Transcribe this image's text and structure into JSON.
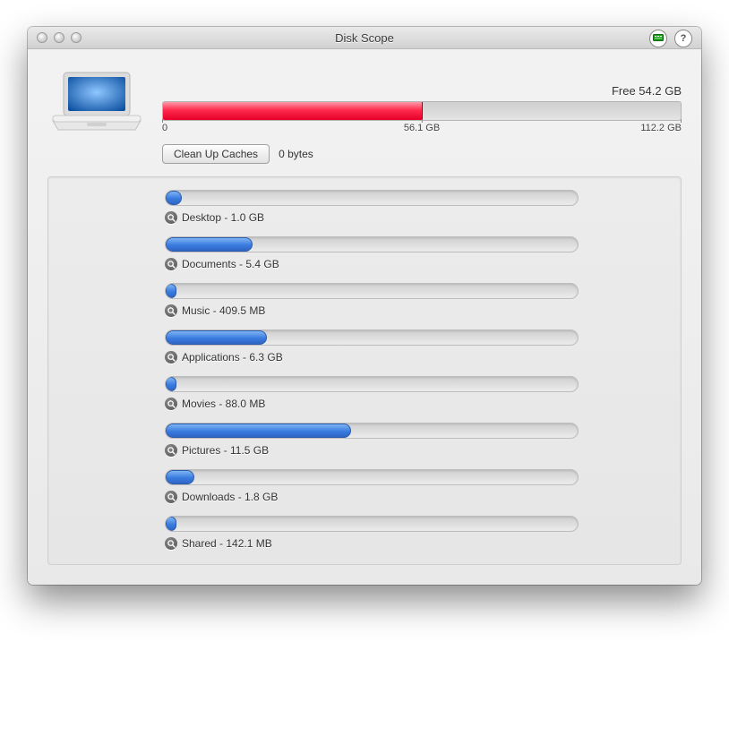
{
  "window": {
    "title": "Disk Scope"
  },
  "header_icons": {
    "board": "board-icon",
    "help": "help-icon",
    "help_label": "?"
  },
  "disk": {
    "free_label": "Free 54.2 GB",
    "total_label": "112.2 GB",
    "used_label": "56.1 GB",
    "zero_label": "0",
    "used_gb": 56.1,
    "total_gb": 112.2
  },
  "cache": {
    "button_label": "Clean Up Caches",
    "size_label": "0 bytes"
  },
  "folders": [
    {
      "name": "Desktop",
      "size_label": "1.0 GB",
      "bytes": 1073741824
    },
    {
      "name": "Documents",
      "size_label": "5.4 GB",
      "bytes": 5798205849
    },
    {
      "name": "Music",
      "size_label": "409.5 MB",
      "bytes": 429391872
    },
    {
      "name": "Applications",
      "size_label": "6.3 GB",
      "bytes": 6764573491
    },
    {
      "name": "Movies",
      "size_label": "88.0 MB",
      "bytes": 92274688
    },
    {
      "name": "Pictures",
      "size_label": "11.5 GB",
      "bytes": 12348030976
    },
    {
      "name": "Downloads",
      "size_label": "1.8 GB",
      "bytes": 1932735283
    },
    {
      "name": "Shared",
      "size_label": "142.1 MB",
      "bytes": 149002649
    }
  ],
  "folder_bar_scale_gb": 112.2
}
